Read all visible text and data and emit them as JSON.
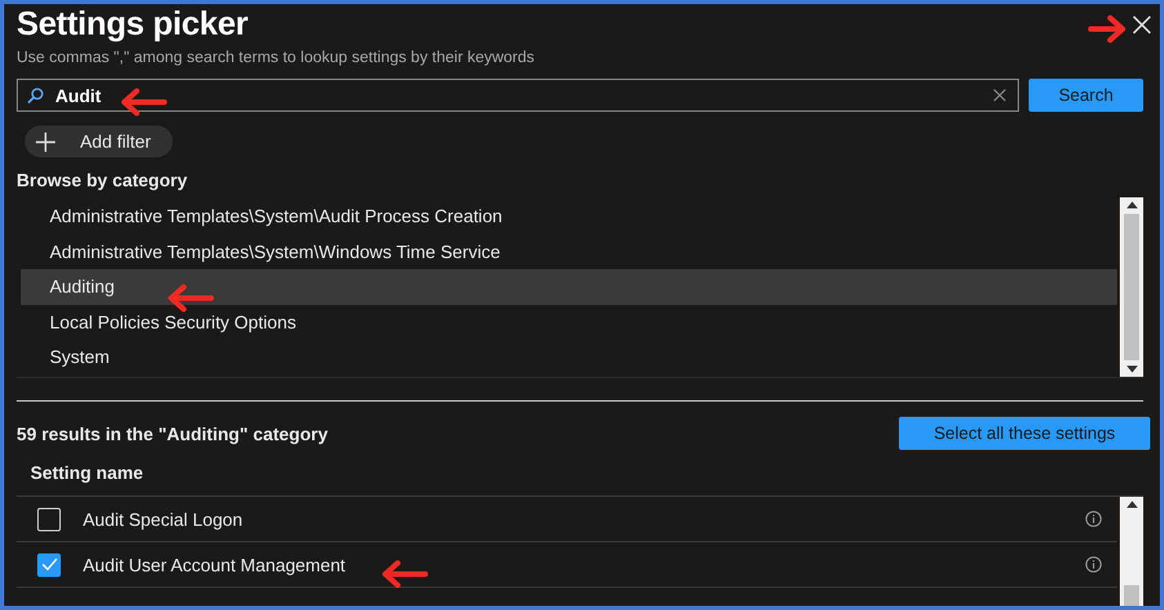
{
  "title": "Settings picker",
  "subtitle": "Use commas \",\" among search terms to lookup settings by their keywords",
  "search": {
    "value": "Audit",
    "button": "Search"
  },
  "add_filter": "Add filter",
  "browse": {
    "heading": "Browse by category",
    "categories": [
      {
        "label": "Administrative Templates\\System\\Audit Process Creation",
        "selected": false
      },
      {
        "label": "Administrative Templates\\System\\Windows Time Service",
        "selected": false
      },
      {
        "label": "Auditing",
        "selected": true
      },
      {
        "label": "Local Policies Security Options",
        "selected": false
      },
      {
        "label": "System",
        "selected": false
      }
    ]
  },
  "results": {
    "summary": "59 results in the \"Auditing\" category",
    "select_all": "Select all these settings",
    "column": "Setting name",
    "rows": [
      {
        "label": "Audit Special Logon",
        "checked": false
      },
      {
        "label": "Audit User Account Management",
        "checked": true
      }
    ]
  }
}
